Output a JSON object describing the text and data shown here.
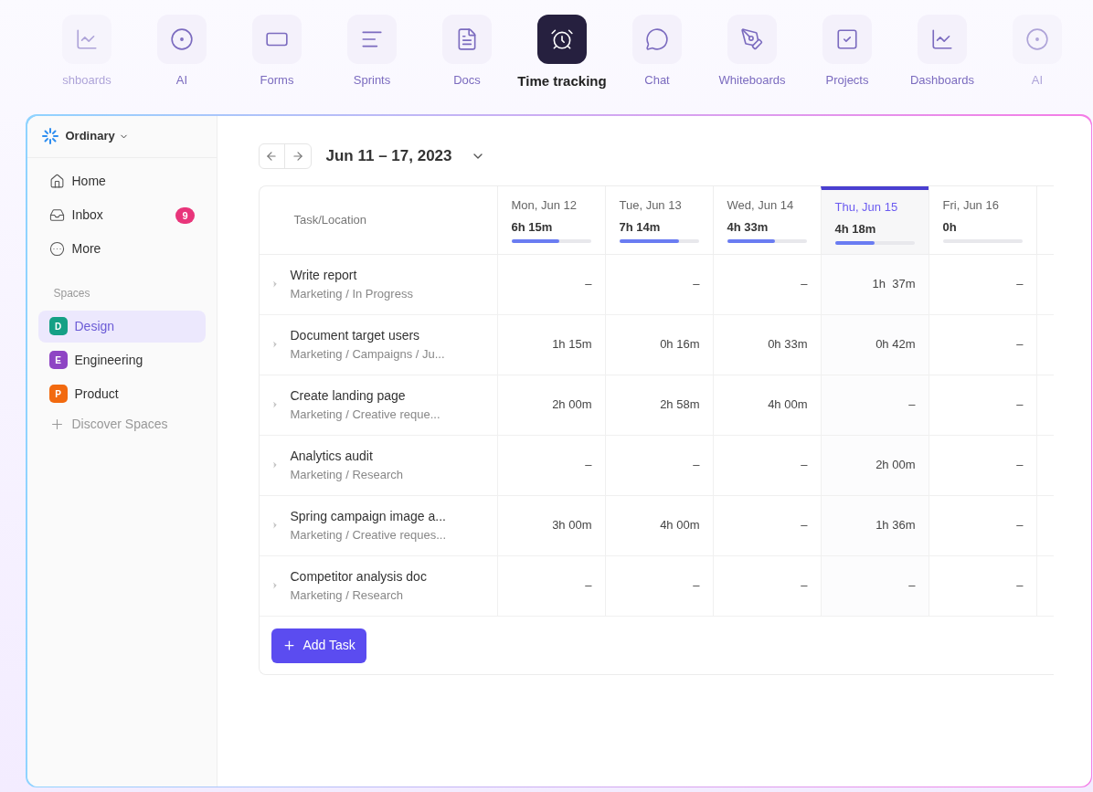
{
  "top_nav": [
    {
      "label": "shboards",
      "selected": false
    },
    {
      "label": "AI",
      "selected": false
    },
    {
      "label": "Forms",
      "selected": false
    },
    {
      "label": "Sprints",
      "selected": false
    },
    {
      "label": "Docs",
      "selected": false
    },
    {
      "label": "Time tracking",
      "selected": true
    },
    {
      "label": "Chat",
      "selected": false
    },
    {
      "label": "Whiteboards",
      "selected": false
    },
    {
      "label": "Projects",
      "selected": false
    },
    {
      "label": "Dashboards",
      "selected": false
    },
    {
      "label": "AI",
      "selected": false
    }
  ],
  "workspace": {
    "name": "Ordinary"
  },
  "sidebar": {
    "items": [
      {
        "label": "Home"
      },
      {
        "label": "Inbox",
        "badge": "9"
      },
      {
        "label": "More"
      }
    ],
    "spaces_heading": "Spaces",
    "spaces": [
      {
        "letter": "D",
        "label": "Design",
        "color": "#14a085",
        "selected": true
      },
      {
        "letter": "E",
        "label": "Engineering",
        "color": "#8e44c4",
        "selected": false
      },
      {
        "letter": "P",
        "label": "Product",
        "color": "#f26a0f",
        "selected": false
      }
    ],
    "discover": "Discover Spaces"
  },
  "date_range": "Jun 11 – 17, 2023",
  "table": {
    "task_heading": "Task/Location",
    "days": [
      {
        "day": "Mon, Jun 12",
        "total": "6h 15m",
        "level": 0.6,
        "selected": false
      },
      {
        "day": "Tue, Jun 13",
        "total": "7h 14m",
        "level": 0.75,
        "selected": false
      },
      {
        "day": "Wed, Jun 14",
        "total": "4h 33m",
        "level": 0.6,
        "selected": false
      },
      {
        "day": "Thu, Jun 15",
        "total": "4h 18m",
        "level": 0.5,
        "selected": true
      },
      {
        "day": "Fri, Jun 16",
        "total": "0h",
        "level": 0,
        "selected": false
      }
    ],
    "rows": [
      {
        "task": "Write report",
        "location": "Marketing / In Progress",
        "cells": [
          "–",
          "–",
          "–",
          "1h  37m",
          "–"
        ]
      },
      {
        "task": "Document target users",
        "location": "Marketing / Campaigns / Ju...",
        "cells": [
          "1h 15m",
          "0h 16m",
          "0h 33m",
          "0h 42m",
          "–"
        ]
      },
      {
        "task": "Create landing page",
        "location": "Marketing / Creative reque...",
        "cells": [
          "2h 00m",
          "2h 58m",
          "4h 00m",
          "–",
          "–"
        ]
      },
      {
        "task": "Analytics audit",
        "location": "Marketing / Research",
        "cells": [
          "–",
          "–",
          "–",
          "2h 00m",
          "–"
        ]
      },
      {
        "task": "Spring campaign image a...",
        "location": "Marketing / Creative reques...",
        "cells": [
          "3h 00m",
          "4h 00m",
          "–",
          "1h 36m",
          "–"
        ]
      },
      {
        "task": "Competitor analysis doc",
        "location": "Marketing / Research",
        "cells": [
          "–",
          "–",
          "–",
          "–",
          "–"
        ]
      }
    ]
  },
  "add_task": "Add Task"
}
